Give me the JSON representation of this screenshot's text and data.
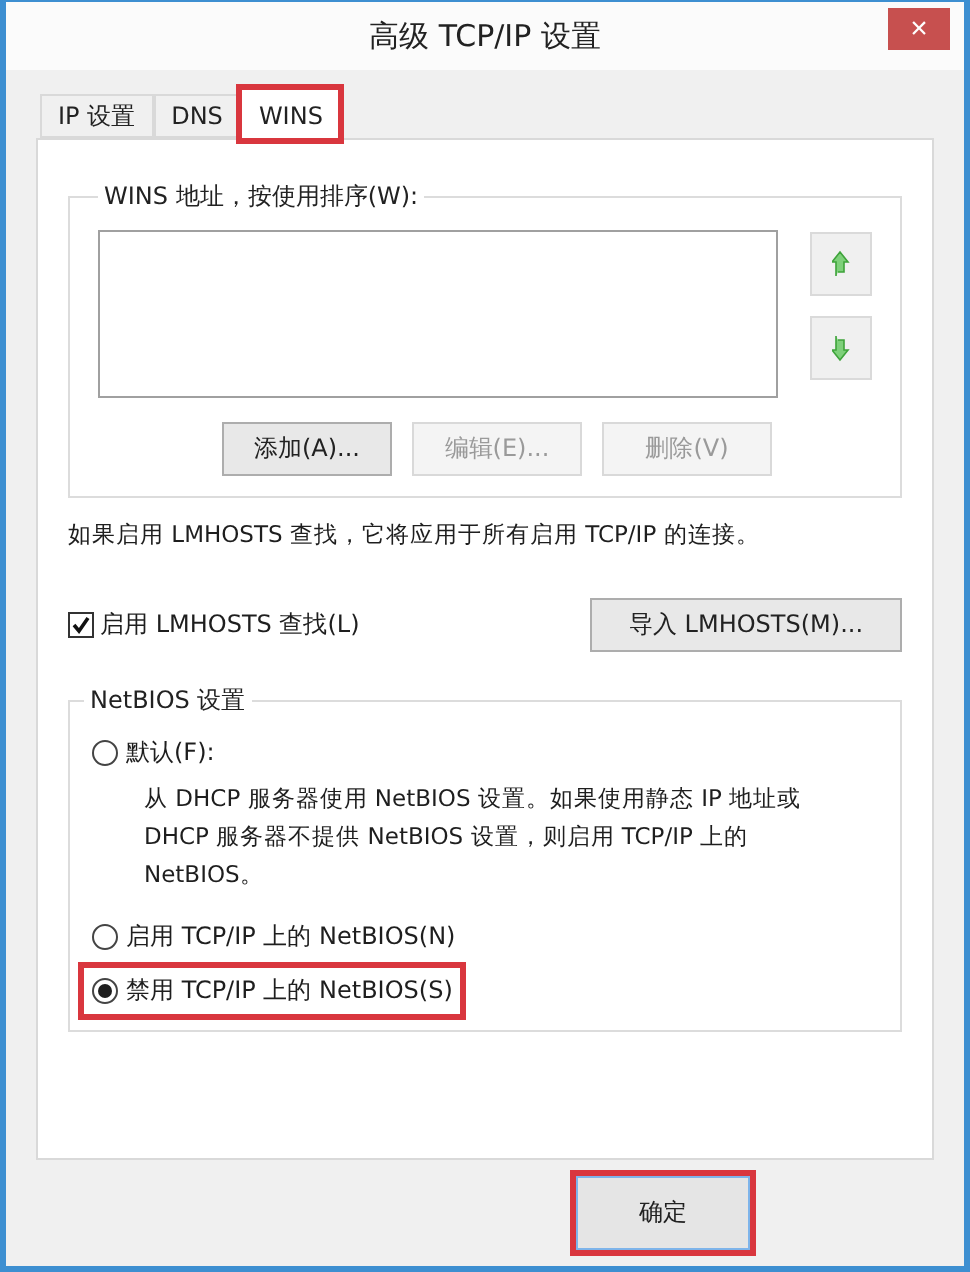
{
  "window": {
    "title": "高级 TCP/IP 设置",
    "close": "×"
  },
  "tabs": [
    {
      "label": "IP 设置",
      "selected": false,
      "highlighted": false
    },
    {
      "label": "DNS",
      "selected": false,
      "highlighted": false
    },
    {
      "label": "WINS",
      "selected": true,
      "highlighted": true
    }
  ],
  "wins_group": {
    "title": "WINS 地址，按使用排序(W):",
    "buttons": [
      {
        "label": "添加(A)...",
        "disabled": false
      },
      {
        "label": "编辑(E)...",
        "disabled": true
      },
      {
        "label": "删除(V)",
        "disabled": true
      }
    ]
  },
  "note": "如果启用 LMHOSTS 查找，它将应用于所有启用 TCP/IP 的连接。",
  "lmhosts": {
    "label": "启用 LMHOSTS 查找(L)",
    "checked": true,
    "import_button": "导入 LMHOSTS(M)..."
  },
  "netbios_group": {
    "title": "NetBIOS 设置",
    "options": [
      {
        "label": "默认(F):",
        "selected": false,
        "highlighted": false,
        "description": "从 DHCP 服务器使用 NetBIOS 设置。如果使用静态 IP 地址或 DHCP 服务器不提供 NetBIOS 设置，则启用 TCP/IP 上的 NetBIOS。"
      },
      {
        "label": "启用 TCP/IP 上的 NetBIOS(N)",
        "selected": false,
        "highlighted": false
      },
      {
        "label": "禁用 TCP/IP 上的 NetBIOS(S)",
        "selected": true,
        "highlighted": true
      }
    ]
  },
  "ok_button": {
    "label": "确定",
    "highlighted": true
  }
}
